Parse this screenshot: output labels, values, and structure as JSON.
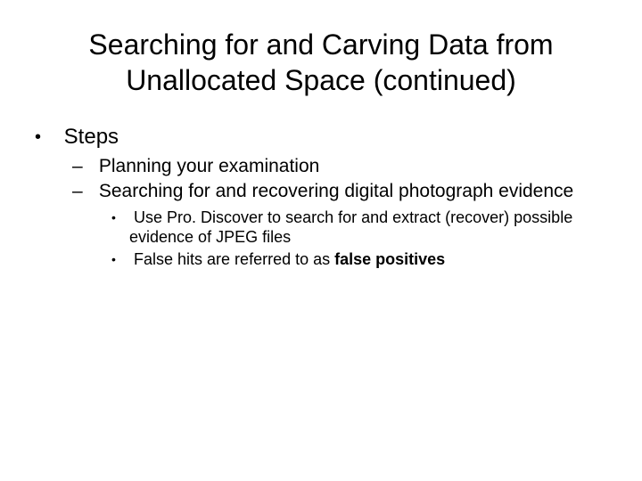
{
  "title": "Searching for and Carving Data from Unallocated Space (continued)",
  "bullets": [
    {
      "text": "Steps",
      "children": [
        {
          "text": "Planning your examination"
        },
        {
          "text": "Searching for and recovering digital photograph evidence",
          "children": [
            {
              "text": "Use Pro. Discover to search for and extract (recover) possible evidence of JPEG files"
            },
            {
              "prefix": "False hits are referred to as ",
              "bold": "false positives"
            }
          ]
        }
      ]
    }
  ]
}
